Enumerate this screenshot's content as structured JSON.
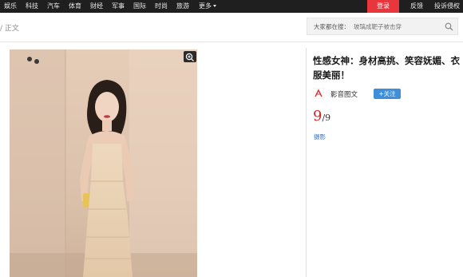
{
  "nav": {
    "items": [
      "娱乐",
      "科技",
      "汽车",
      "体育",
      "财经",
      "军事",
      "国际",
      "时尚",
      "旅游",
      "更多"
    ],
    "login_label": "登录",
    "feedback_label": "反馈",
    "complaint_label": "投诉侵权"
  },
  "breadcrumb": {
    "text": "/ 正文"
  },
  "search": {
    "prefix": "大家都在搜：",
    "value": "玻璃成靶子被击穿"
  },
  "article": {
    "title": "性感女神：身材高挑、笑容妩媚、衣服美丽！",
    "author": "影音图文",
    "follow_label": "+关注",
    "current": "9",
    "separator": "/",
    "total": "9",
    "category": "摄影"
  },
  "colors": {
    "nav_bg": "#1f1f1f",
    "login_red": "#e8363c",
    "follow_blue": "#3e8ed8",
    "counter_red": "#cc2a2a",
    "link_blue": "#3a6fb8"
  }
}
